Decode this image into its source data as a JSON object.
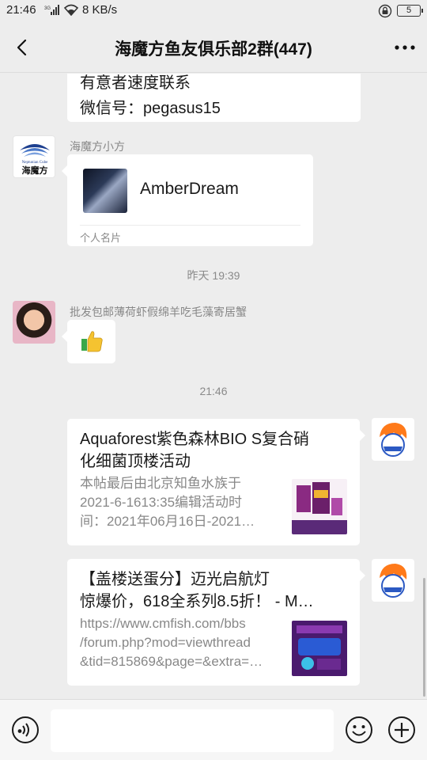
{
  "status_bar": {
    "time": "21:46",
    "network": "3G",
    "speed": "8 KB/s",
    "battery": "5"
  },
  "nav": {
    "title": "海魔方鱼友俱乐部2群(447)"
  },
  "messages": {
    "top_partial": {
      "line1": "有意者速度联系",
      "line2": "微信号：pegasus15"
    },
    "card_msg": {
      "sender": "海魔方小方",
      "avatar_text_en": "Neptunian Cube",
      "avatar_text_cn": "海魔方",
      "card_name": "AmberDream",
      "card_footer": "个人名片"
    },
    "timestamp_1": "昨天 19:39",
    "thumb_msg": {
      "sender": "批发包邮薄荷虾假绵羊吃毛藻寄居蟹",
      "emoji": "👍"
    },
    "timestamp_2": "21:46",
    "link_1": {
      "title_line1": "Aquaforest紫色森林BIO S复合硝",
      "title_line2": "化细菌顶楼活动",
      "desc_line1": "本帖最后由北京知鱼水族于",
      "desc_line2": "2021-6-1613:35编辑活动时",
      "desc_line3": "间：2021年06月16日-2021…"
    },
    "link_2": {
      "title_line1": "【盖楼送蛋分】迈光启航灯",
      "title_line2": "惊爆价，618全系列8.5折！ - M…",
      "desc_line1": "https://www.cmfish.com/bbs",
      "desc_line2": "/forum.php?mod=viewthread",
      "desc_line3": "&tid=815869&page=&extra=…"
    }
  },
  "input_bar": {
    "placeholder": ""
  },
  "colors": {
    "background": "#ededed",
    "bubble": "#ffffff",
    "timestamp": "#8a8a8a"
  }
}
